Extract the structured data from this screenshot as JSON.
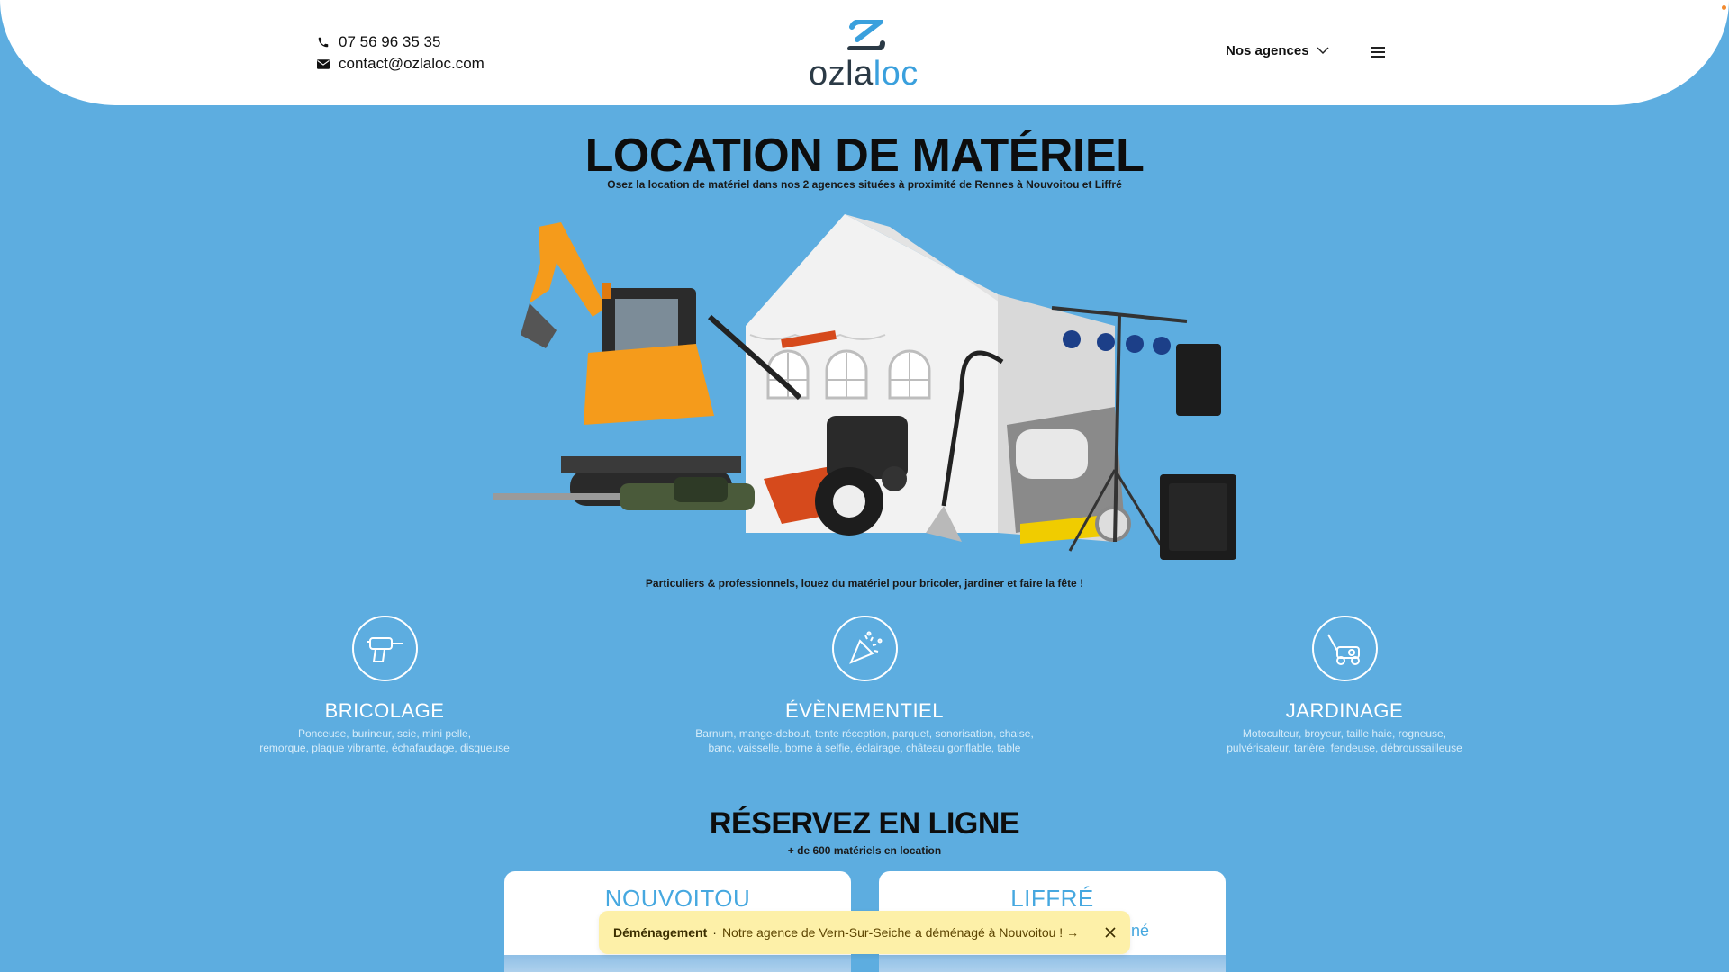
{
  "header": {
    "phone": "07 56 96 35 35",
    "email": "contact@ozlaloc.com",
    "logo_part1": "ozla",
    "logo_part2": "loc",
    "agences_label": "Nos agences",
    "icons": {
      "phone": "phone-icon",
      "email": "envelope-icon",
      "agences": "chevron-down-icon",
      "menu": "hamburger-menu-icon"
    }
  },
  "hero": {
    "title": "LOCATION DE MATÉRIEL",
    "subtitle": "Osez la location de matériel dans nos 2 agences situées à proximité de Rennes à Nouvoitou et Liffré",
    "tagline": "Particuliers & professionnels, louez du matériel pour bricoler, jardiner et faire la fête !"
  },
  "categories": [
    {
      "name": "BRICOLAGE",
      "icon": "drill-icon",
      "desc1": "Ponceuse, burineur, scie, mini pelle,",
      "desc2": "remorque, plaque vibrante, échafaudage, disqueuse"
    },
    {
      "name": "ÉVÈNEMENTIEL",
      "icon": "party-icon",
      "desc1": "Barnum, mange-debout, tente réception, parquet, sonorisation, chaise,",
      "desc2": "banc, vaisselle, borne à selfie, éclairage, château gonflable, table"
    },
    {
      "name": "JARDINAGE",
      "icon": "lawn-mower-icon",
      "desc1": "Motoculteur, broyeur, taille haie, rogneuse,",
      "desc2": "pulvérisateur, tarière, fendeuse, débroussailleuse"
    }
  ],
  "booking": {
    "title": "RÉSERVEZ EN LIGNE",
    "subtitle": "+ de 600 matériels en location",
    "agencies": [
      {
        "name": "NOUVOITOU"
      },
      {
        "name": "LIFFRÉ",
        "partial_text": "né"
      }
    ]
  },
  "toast": {
    "label": "Déménagement",
    "separator": "·",
    "message": "Notre agence de Vern-Sur-Seiche a déménagé à Nouvoitou ! →"
  },
  "colors": {
    "background": "#5dade0",
    "accent": "#46a8e0",
    "logo_dark": "#2b3a46",
    "toast_bg": "#fdf0a8"
  }
}
